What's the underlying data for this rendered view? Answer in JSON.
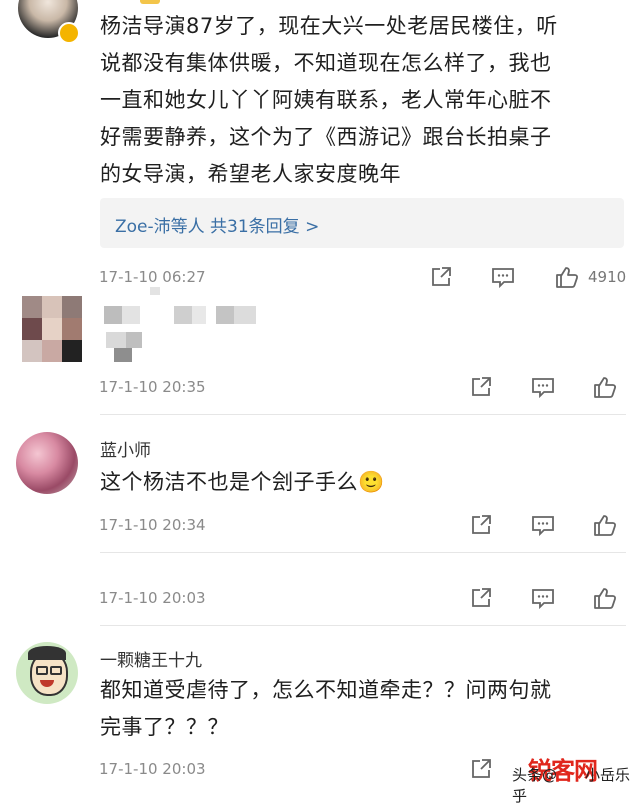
{
  "comments": [
    {
      "text_lines": [
        "杨洁导演87岁了，现在大兴一处老居民楼住，听",
        "说都没有集体供暖，不知道现在怎么样了，我也",
        "一直和她女儿丫丫阿姨有联系，老人常年心脏不",
        "好需要静养，这个为了《西游记》跟台长拍桌子",
        "的女导演，希望老人家安度晚年"
      ],
      "reply_summary": "Zoe-沛等人 共31条回复 >",
      "timestamp": "17-1-10 06:27",
      "like_count": "4910"
    },
    {
      "timestamp": "17-1-10 20:35"
    },
    {
      "username": "蓝小师",
      "text_lines": [
        "这个杨洁不也是个刽子手么🙂"
      ],
      "timestamp": "17-1-10 20:34"
    },
    {
      "timestamp": "17-1-10 20:03"
    },
    {
      "username": "一颗糖王十九",
      "text_lines": [
        "都知道受虐待了，怎么不知道牵走？？问两句就",
        "完事了？？？"
      ],
      "timestamp": "17-1-10 20:03"
    }
  ],
  "watermark": {
    "site": "锐客网",
    "prefix": "头条@",
    "author": "小岳乐乎"
  },
  "icons": [
    "share-icon",
    "comment-icon",
    "like-icon",
    "verified-badge-icon"
  ]
}
